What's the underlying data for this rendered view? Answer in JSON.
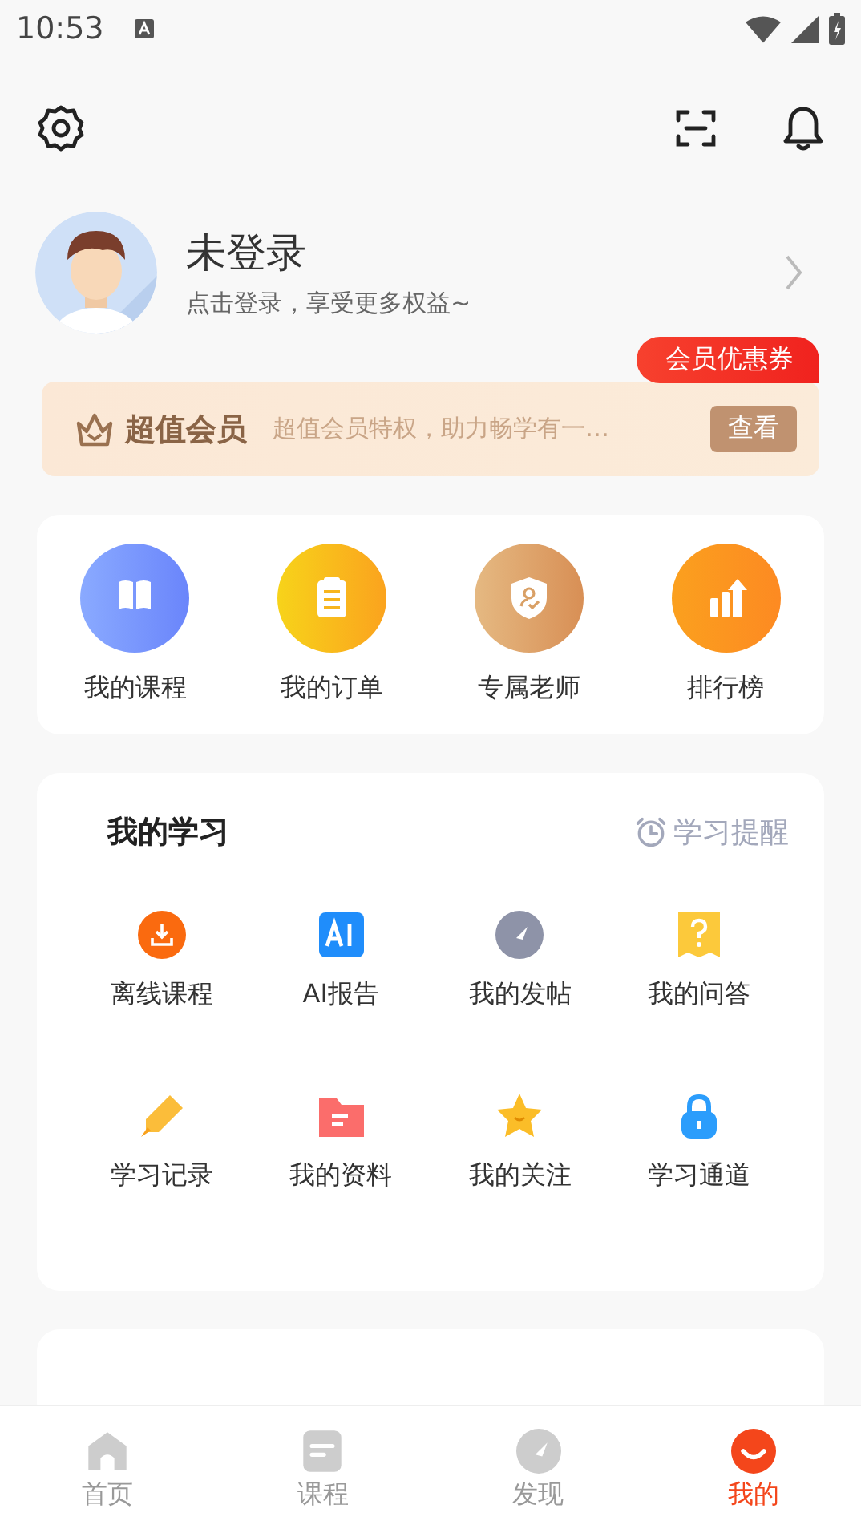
{
  "status_bar": {
    "time": "10:53"
  },
  "profile": {
    "name": "未登录",
    "subtitle": "点击登录，享受更多权益~"
  },
  "vip": {
    "badge": "会员优惠券",
    "title": "超值会员",
    "description": "超值会员特权，助力畅学有一…",
    "button": "查看"
  },
  "quick_links": [
    {
      "label": "我的课程"
    },
    {
      "label": "我的订单"
    },
    {
      "label": "专属老师"
    },
    {
      "label": "排行榜"
    }
  ],
  "study": {
    "title": "我的学习",
    "reminder": "学习提醒",
    "items": [
      {
        "label": "离线课程"
      },
      {
        "label": "AI报告"
      },
      {
        "label": "我的发帖"
      },
      {
        "label": "我的问答"
      },
      {
        "label": "学习记录"
      },
      {
        "label": "我的资料"
      },
      {
        "label": "我的关注"
      },
      {
        "label": "学习通道"
      }
    ]
  },
  "tabs": [
    {
      "label": "首页",
      "selected": false
    },
    {
      "label": "课程",
      "selected": false
    },
    {
      "label": "发现",
      "selected": false
    },
    {
      "label": "我的",
      "selected": true
    }
  ]
}
